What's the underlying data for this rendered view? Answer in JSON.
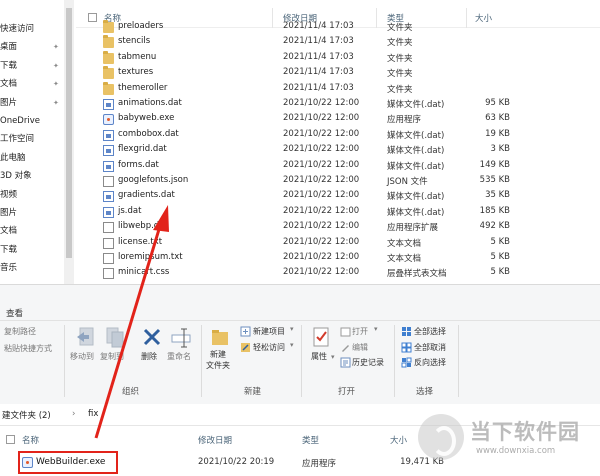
{
  "nav_pane": {
    "items": [
      {
        "label": "快速访问",
        "pinned": false
      },
      {
        "label": "桌面",
        "pinned": true
      },
      {
        "label": "下载",
        "pinned": true
      },
      {
        "label": "文档",
        "pinned": true
      },
      {
        "label": "图片",
        "pinned": true
      },
      {
        "label": "OneDrive",
        "pinned": false
      },
      {
        "label": "工作空间",
        "pinned": false
      },
      {
        "label": "此电脑",
        "pinned": false
      },
      {
        "label": "3D 对象",
        "pinned": false
      },
      {
        "label": "视频",
        "pinned": false
      },
      {
        "label": "图片",
        "pinned": false
      },
      {
        "label": "文档",
        "pinned": false
      },
      {
        "label": "下载",
        "pinned": false
      },
      {
        "label": "音乐",
        "pinned": false
      }
    ],
    "pin_glyph": "✦"
  },
  "file_list": {
    "columns": {
      "name": "名称",
      "date": "修改日期",
      "type": "类型",
      "size": "大小"
    },
    "rows": [
      {
        "name": "preloaders",
        "date": "2021/11/4 17:03",
        "type": "文件夹",
        "size": "",
        "icon": "folder-icon"
      },
      {
        "name": "stencils",
        "date": "2021/11/4 17:03",
        "type": "文件夹",
        "size": "",
        "icon": "folder-icon"
      },
      {
        "name": "tabmenu",
        "date": "2021/11/4 17:03",
        "type": "文件夹",
        "size": "",
        "icon": "folder-icon"
      },
      {
        "name": "textures",
        "date": "2021/11/4 17:03",
        "type": "文件夹",
        "size": "",
        "icon": "folder-icon"
      },
      {
        "name": "themeroller",
        "date": "2021/11/4 17:03",
        "type": "文件夹",
        "size": "",
        "icon": "folder-icon"
      },
      {
        "name": "animations.dat",
        "date": "2021/10/22 12:00",
        "type": "媒体文件(.dat)",
        "size": "95 KB",
        "icon": "dat-file-icon"
      },
      {
        "name": "babyweb.exe",
        "date": "2021/10/22 12:00",
        "type": "应用程序",
        "size": "63 KB",
        "icon": "exe-file-icon"
      },
      {
        "name": "combobox.dat",
        "date": "2021/10/22 12:00",
        "type": "媒体文件(.dat)",
        "size": "19 KB",
        "icon": "dat-file-icon"
      },
      {
        "name": "flexgrid.dat",
        "date": "2021/10/22 12:00",
        "type": "媒体文件(.dat)",
        "size": "3 KB",
        "icon": "dat-file-icon"
      },
      {
        "name": "forms.dat",
        "date": "2021/10/22 12:00",
        "type": "媒体文件(.dat)",
        "size": "149 KB",
        "icon": "dat-file-icon"
      },
      {
        "name": "googlefonts.json",
        "date": "2021/10/22 12:00",
        "type": "JSON 文件",
        "size": "535 KB",
        "icon": "document-file-icon"
      },
      {
        "name": "gradients.dat",
        "date": "2021/10/22 12:00",
        "type": "媒体文件(.dat)",
        "size": "35 KB",
        "icon": "dat-file-icon"
      },
      {
        "name": "js.dat",
        "date": "2021/10/22 12:00",
        "type": "媒体文件(.dat)",
        "size": "185 KB",
        "icon": "dat-file-icon"
      },
      {
        "name": "libwebp.dll",
        "date": "2021/10/22 12:00",
        "type": "应用程序扩展",
        "size": "492 KB",
        "icon": "document-file-icon"
      },
      {
        "name": "license.txt",
        "date": "2021/10/22 12:00",
        "type": "文本文档",
        "size": "5 KB",
        "icon": "document-file-icon"
      },
      {
        "name": "loremipsum.txt",
        "date": "2021/10/22 12:00",
        "type": "文本文档",
        "size": "5 KB",
        "icon": "document-file-icon"
      },
      {
        "name": "minicart.css",
        "date": "2021/10/22 12:00",
        "type": "层叠样式表文档",
        "size": "5 KB",
        "icon": "document-file-icon"
      }
    ]
  },
  "ribbon": {
    "tab": "查看",
    "copy_path": "复制路径",
    "paste_shortcut": "粘贴快捷方式",
    "move_to": "移动到",
    "copy_to": "复制到",
    "delete": "删除",
    "rename": "重命名",
    "organize": "组织",
    "new_item": "新建项目",
    "easy_access": "轻松访问",
    "new_folder_line1": "新建",
    "new_folder_line2": "文件夹",
    "new_group": "新建",
    "properties": "属性",
    "open": "打开",
    "edit": "编辑",
    "history": "历史记录",
    "open_group": "打开",
    "select_all": "全部选择",
    "select_none": "全部取消",
    "invert_selection": "反向选择",
    "select_group": "选择"
  },
  "address_bar": {
    "crumb_parent": "建文件夹 (2)",
    "crumb_separator": "›",
    "crumb_current": "fix"
  },
  "bottom_list": {
    "columns": {
      "name": "名称",
      "date": "修改日期",
      "type": "类型",
      "size": "大小"
    },
    "row": {
      "name": "WebBuilder.exe",
      "date": "2021/10/22 20:19",
      "type": "应用程序",
      "size": "19,471 KB"
    }
  },
  "watermark": {
    "title": "当下软件园",
    "url": "www.downxia.com"
  },
  "colors": {
    "annotation_red": "#e2231a",
    "folder": "#e9c265",
    "header_text": "#4a6478"
  }
}
